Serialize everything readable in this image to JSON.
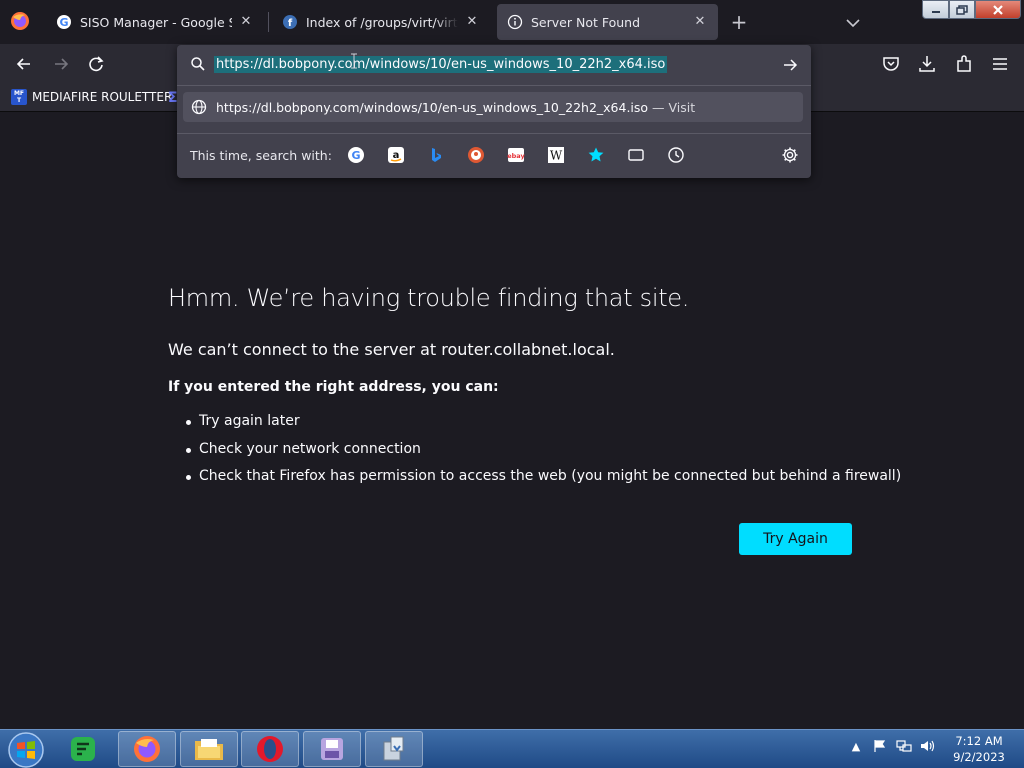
{
  "tabs": [
    {
      "title": "SISO Manager - Google Search",
      "icon": "google-icon",
      "active": false
    },
    {
      "title": "Index of /groups/virt/virtio-win",
      "icon": "fedora-icon",
      "active": false
    },
    {
      "title": "Server Not Found",
      "icon": "info-icon",
      "active": true
    }
  ],
  "new_tab_label": "+",
  "bookmarks": [
    {
      "label": "MEDIAFIRE ROULETTER",
      "icon": "mediafire-icon",
      "icon_text": "MF T"
    }
  ],
  "url_bar": {
    "value": "https://dl.bobpony.com/windows/10/en-us_windows_10_22h2_x64.iso"
  },
  "suggestion": {
    "url": "https://dl.bobpony.com/windows/10/en-us_windows_10_22h2_x64.iso",
    "action": "— Visit"
  },
  "search_with": {
    "label": "This time, search with:",
    "engines": [
      "google-icon",
      "amazon-icon",
      "bing-icon",
      "duckduckgo-icon",
      "ebay-icon",
      "wikipedia-icon",
      "bookmarks-star-icon",
      "tabs-icon",
      "history-icon"
    ]
  },
  "error": {
    "title": "Hmm. We’re having trouble finding that site.",
    "short": "We can’t connect to the server at router.collabnet.local.",
    "heading": "If you entered the right address, you can:",
    "items": [
      "Try again later",
      "Check your network connection",
      "Check that Firefox has permission to access the web (you might be connected but behind a firewall)"
    ],
    "button": "Try Again"
  },
  "colors": {
    "accent": "#00ddff",
    "page_bg": "#1c1b22",
    "toolbar_bg": "#2b2a33",
    "url_highlight": "#1d6f7b",
    "taskbar": "#2a5a96"
  },
  "taskbar": {
    "apps": [
      "firefox-icon",
      "file-explorer-icon",
      "opera-icon",
      "disk-utility-icon",
      "installer-icon"
    ],
    "pinned_first": "feedly-icon",
    "tray": [
      "show-hidden-icons",
      "action-center-flag-icon",
      "network-icon",
      "volume-icon"
    ],
    "time": "7:12 AM",
    "date": "9/2/2023"
  }
}
